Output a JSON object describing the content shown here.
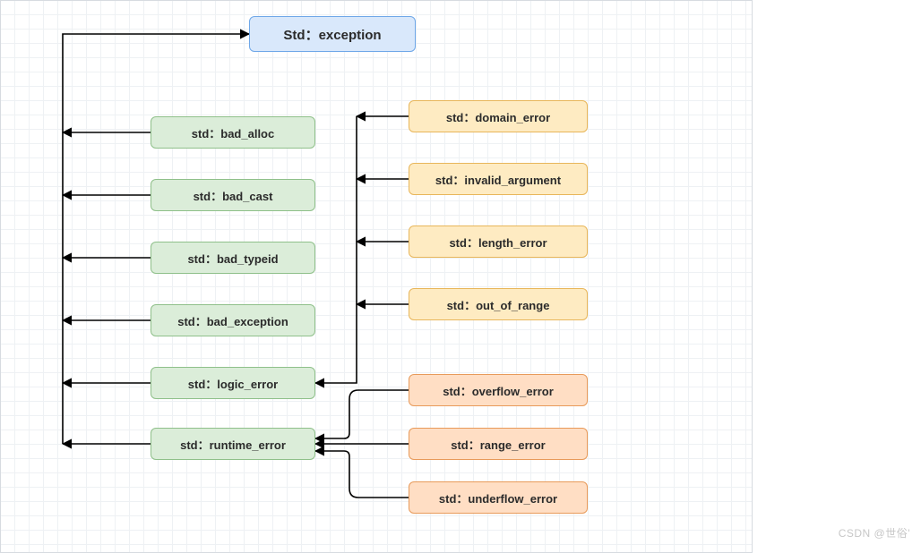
{
  "root": {
    "label": "Std：exception"
  },
  "green_nodes": [
    {
      "key": "bad_alloc",
      "label": "std：bad_alloc"
    },
    {
      "key": "bad_cast",
      "label": "std：bad_cast"
    },
    {
      "key": "bad_typeid",
      "label": "std：bad_typeid"
    },
    {
      "key": "bad_exception",
      "label": "std：bad_exception"
    },
    {
      "key": "logic_error",
      "label": "std：logic_error"
    },
    {
      "key": "runtime_error",
      "label": "std：runtime_error"
    }
  ],
  "logic_children": [
    {
      "key": "domain_error",
      "label": "std：domain_error"
    },
    {
      "key": "invalid_argument",
      "label": "std：invalid_argument"
    },
    {
      "key": "length_error",
      "label": "std：length_error"
    },
    {
      "key": "out_of_range",
      "label": "std：out_of_range"
    }
  ],
  "runtime_children": [
    {
      "key": "overflow_error",
      "label": "std：overflow_error"
    },
    {
      "key": "range_error",
      "label": "std：range_error"
    },
    {
      "key": "underflow_error",
      "label": "std：underflow_error"
    }
  ],
  "watermark": "CSDN @世俗'"
}
